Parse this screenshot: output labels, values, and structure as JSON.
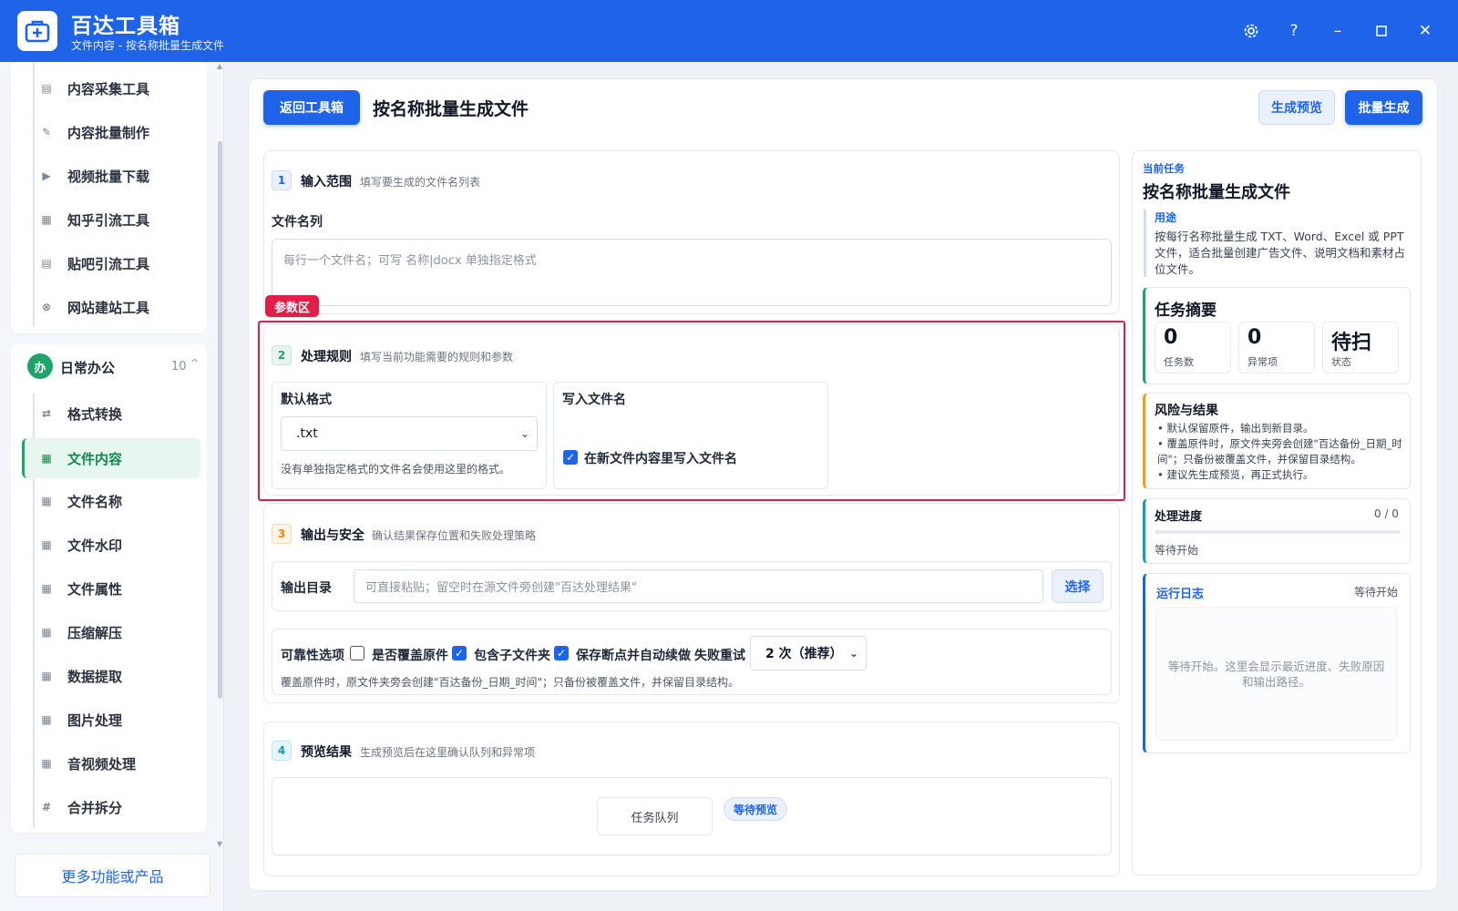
{
  "app": {
    "title": "百达工具箱",
    "subtitle": "文件内容 - 按名称批量生成文件"
  },
  "window_controls": [
    "settings-icon",
    "help-icon",
    "minimize-icon",
    "maximize-icon",
    "close-icon"
  ],
  "sidebar": {
    "top_items": [
      {
        "label": "内容采集工具",
        "icon": "clipboard-icon"
      },
      {
        "label": "内容批量制作",
        "icon": "pen-icon"
      },
      {
        "label": "视频批量下载",
        "icon": "video-icon"
      },
      {
        "label": "知乎引流工具",
        "icon": "zhihu-icon"
      },
      {
        "label": "贴吧引流工具",
        "icon": "tieba-icon"
      },
      {
        "label": "网站建站工具",
        "icon": "globe-icon"
      }
    ],
    "group": {
      "badge": "办",
      "title": "日常办公",
      "count": "10",
      "caret": "^"
    },
    "group_items": [
      {
        "label": "格式转换",
        "icon": "convert-icon"
      },
      {
        "label": "文件内容",
        "icon": "grid-icon"
      },
      {
        "label": "文件名称",
        "icon": "grid-icon"
      },
      {
        "label": "文件水印",
        "icon": "grid-icon"
      },
      {
        "label": "文件属性",
        "icon": "grid-icon"
      },
      {
        "label": "压缩解压",
        "icon": "grid-icon"
      },
      {
        "label": "数据提取",
        "icon": "grid-icon"
      },
      {
        "label": "图片处理",
        "icon": "grid-icon"
      },
      {
        "label": "音视频处理",
        "icon": "grid-icon"
      },
      {
        "label": "合并拆分",
        "icon": "hash-icon"
      }
    ],
    "active_item": "文件内容",
    "more_label": "更多功能或产品"
  },
  "header": {
    "back_label": "返回工具箱",
    "title": "按名称批量生成文件",
    "preview_label": "生成预览",
    "run_label": "批量生成"
  },
  "section1": {
    "num": "1",
    "title": "输入范围",
    "desc": "填写要生成的文件名列表",
    "field_label": "文件名列",
    "placeholder": "每行一个文件名；可写 名称|docx 单独指定格式"
  },
  "param_badge": "参数区",
  "section2": {
    "num": "2",
    "title": "处理规则",
    "desc": "填写当前功能需要的规则和参数",
    "format_label": "默认格式",
    "format_value": ".txt",
    "format_note": "没有单独指定格式的文件名会使用这里的格式。",
    "write_label": "写入文件名",
    "write_checkbox_label": "在新文件内容里写入文件名",
    "write_checked": true
  },
  "section3": {
    "num": "3",
    "title": "输出与安全",
    "desc": "确认结果保存位置和失败处理策略",
    "output_label": "输出目录",
    "output_placeholder": "可直接粘贴；留空时在源文件旁创建\"百达处理结果\"",
    "choose_label": "选择",
    "reliability_label": "可靠性选项",
    "options": [
      {
        "label": "是否覆盖原件",
        "checked": false
      },
      {
        "label": "包含子文件夹",
        "checked": true
      },
      {
        "label": "保存断点并自动续做",
        "checked": true
      }
    ],
    "retry_label": "失败重试",
    "retry_value": "2 次（推荐）",
    "note": "覆盖原件时，原文件夹旁会创建\"百达备份_日期_时间\"；只备份被覆盖文件，并保留目录结构。"
  },
  "section4": {
    "num": "4",
    "title": "预览结果",
    "desc": "生成预览后在这里确认队列和异常项",
    "queue_label": "任务队列",
    "status_badge": "等待预览"
  },
  "right_panel": {
    "current_label": "当前任务",
    "task_title": "按名称批量生成文件",
    "usage_label": "用途",
    "usage_text": "按每行名称批量生成 TXT、Word、Excel 或 PPT 文件，适合批量创建广告文件、说明文档和素材占位文件。",
    "summary_title": "任务摘要",
    "stats": [
      {
        "value": "0",
        "label": "任务数"
      },
      {
        "value": "0",
        "label": "异常项"
      },
      {
        "value": "待扫",
        "label": "状态"
      }
    ],
    "risk_title": "风险与结果",
    "risk_items": [
      "默认保留原件，输出到新目录。",
      "覆盖原件时，原文件夹旁会创建\"百达备份_日期_时间\"；只备份被覆盖文件，并保留目录结构。",
      "建议先生成预览，再正式执行。"
    ],
    "progress_title": "处理进度",
    "progress_count": "0 / 0",
    "progress_fraction": 0,
    "progress_status": "等待开始",
    "log_title": "运行日志",
    "log_status": "等待开始",
    "log_text": "等待开始。这里会显示最近进度、失败原因和输出路径。"
  },
  "colors": {
    "brand": "#1f64e8",
    "active_green": "#1ea36b",
    "alert_red": "#e11d48",
    "risk_orange": "#f59e0b"
  }
}
